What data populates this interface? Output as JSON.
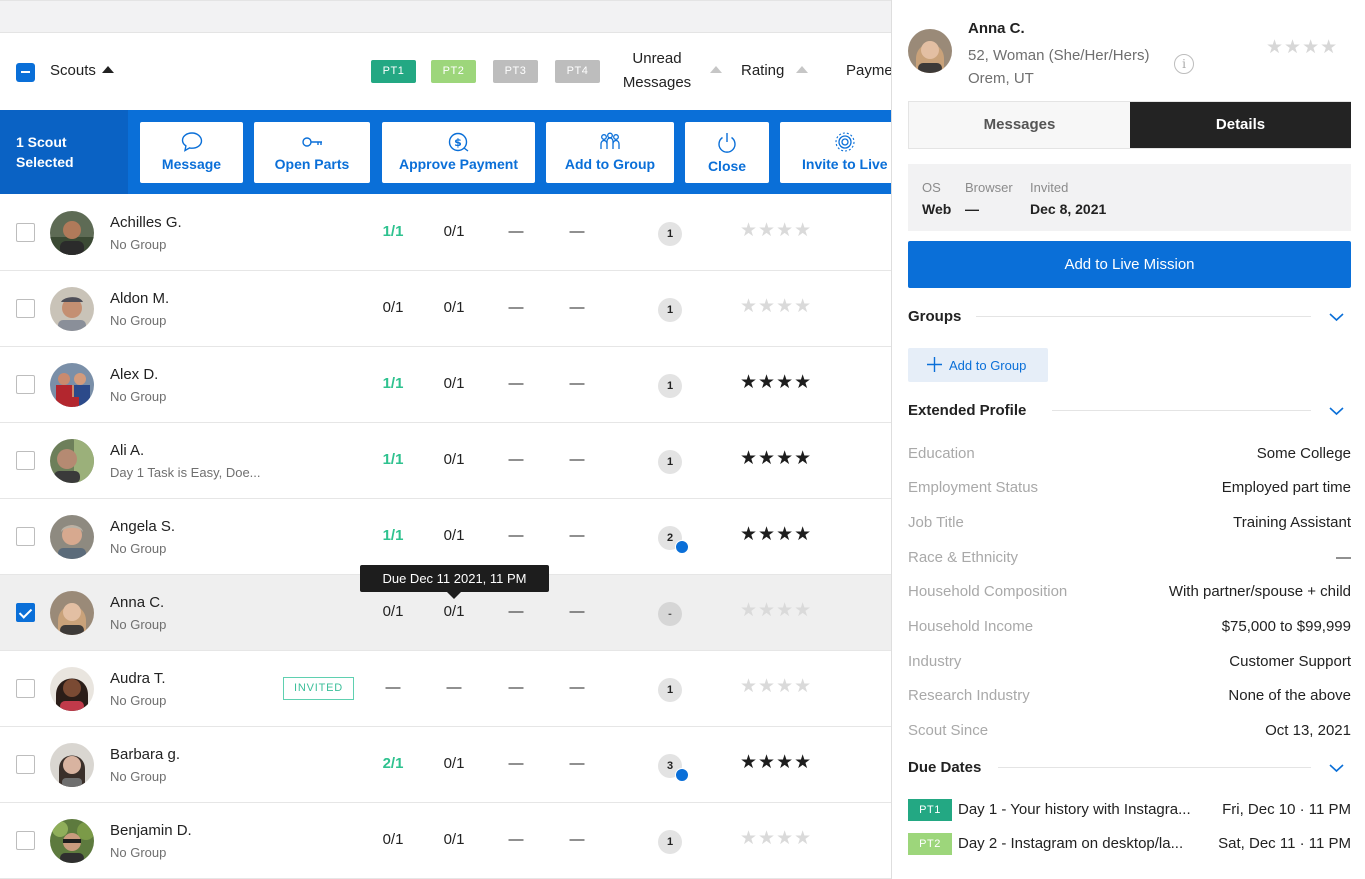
{
  "table": {
    "header": {
      "scouts_label": "Scouts",
      "pt_badges": [
        {
          "label": "PT1",
          "color": "#23a883"
        },
        {
          "label": "PT2",
          "color": "#9dd67b"
        },
        {
          "label": "PT3",
          "color": "#bdbdbd"
        },
        {
          "label": "PT4",
          "color": "#bdbdbd"
        }
      ],
      "unread_line1": "Unread",
      "unread_line2": "Messages",
      "rating_label": "Rating",
      "payment_label": "Payme"
    },
    "action_bar": {
      "selected_line1": "1 Scout",
      "selected_line2": "Selected",
      "buttons": [
        {
          "label": "Message",
          "icon": "chat-bubble-icon"
        },
        {
          "label": "Open Parts",
          "icon": "key-icon"
        },
        {
          "label": "Approve Payment",
          "icon": "dollar-circle-icon"
        },
        {
          "label": "Add to Group",
          "icon": "group-people-icon"
        },
        {
          "label": "Close",
          "icon": "power-icon"
        },
        {
          "label": "Invite to Live",
          "icon": "broadcast-icon"
        }
      ]
    },
    "rows": [
      {
        "name": "Achilles G.",
        "group": "No Group",
        "pt1": "1/1",
        "pt2": "0/1",
        "pt3": "—",
        "pt4": "—",
        "unread": "1",
        "rating": "★★★★"
      },
      {
        "name": "Aldon M.",
        "group": "No Group",
        "pt1": "0/1",
        "pt2": "0/1",
        "pt3": "—",
        "pt4": "—",
        "unread": "1",
        "rating": "★★★★"
      },
      {
        "name": "Alex D.",
        "group": "No Group",
        "pt1": "1/1",
        "pt2": "0/1",
        "pt3": "—",
        "pt4": "—",
        "unread": "1",
        "rating": "★★★★"
      },
      {
        "name": "Ali A.",
        "group": "Day 1 Task is Easy, Doe...",
        "pt1": "1/1",
        "pt2": "0/1",
        "pt3": "—",
        "pt4": "—",
        "unread": "1",
        "rating": "★★★★"
      },
      {
        "name": "Angela S.",
        "group": "No Group",
        "pt1": "1/1",
        "pt2": "0/1",
        "pt3": "—",
        "pt4": "—",
        "unread": "2",
        "rating": "★★★★"
      },
      {
        "name": "Anna C.",
        "group": "No Group",
        "pt1": "0/1",
        "pt2": "0/1",
        "pt3": "—",
        "pt4": "—",
        "unread": "-",
        "rating": "★★★★"
      },
      {
        "name": "Audra T.",
        "group": "No Group",
        "status_badge": "INVITED",
        "pt1": "—",
        "pt2": "—",
        "pt3": "—",
        "pt4": "—",
        "unread": "1",
        "rating": "★★★★"
      },
      {
        "name": "Barbara g.",
        "group": "No Group",
        "pt1": "2/1",
        "pt2": "0/1",
        "pt3": "—",
        "pt4": "—",
        "unread": "3",
        "rating": "★★★★"
      },
      {
        "name": "Benjamin D.",
        "group": "No Group",
        "pt1": "0/1",
        "pt2": "0/1",
        "pt3": "—",
        "pt4": "—",
        "unread": "1",
        "rating": "★★★★"
      }
    ],
    "tooltip": "Due Dec 11 2021, 11 PM"
  },
  "panel": {
    "name": "Anna C.",
    "demographics": "52, Woman (She/Her/Hers)",
    "location": "Orem, UT",
    "info_icon": "i",
    "stars": "★★★★",
    "tabs": {
      "messages": "Messages",
      "details": "Details"
    },
    "system": {
      "os_label": "OS",
      "os_value": "Web",
      "browser_label": "Browser",
      "browser_value": "—",
      "invited_label": "Invited",
      "invited_value": "Dec 8, 2021"
    },
    "live_button": "Add to Live Mission",
    "groups_title": "Groups",
    "add_group_button": "Add to Group",
    "extended_title": "Extended Profile",
    "profile": [
      {
        "key": "Education",
        "value": "Some College"
      },
      {
        "key": "Employment Status",
        "value": "Employed part time"
      },
      {
        "key": "Job Title",
        "value": "Training Assistant"
      },
      {
        "key": "Race & Ethnicity",
        "value": "—"
      },
      {
        "key": "Household Composition",
        "value": "With partner/spouse + child"
      },
      {
        "key": "Household Income",
        "value": "$75,000 to $99,999"
      },
      {
        "key": "Industry",
        "value": "Customer Support"
      },
      {
        "key": "Research Industry",
        "value": "None of the above"
      },
      {
        "key": "Scout Since",
        "value": "Oct 13, 2021"
      }
    ],
    "due_title": "Due Dates",
    "due_dates": [
      {
        "pt": "PT1",
        "color": "#23a883",
        "task": "Day 1 - Your history with Instagra...",
        "date": "Fri, Dec 10 · 11 PM"
      },
      {
        "pt": "PT2",
        "color": "#9dd67b",
        "task": "Day 2 - Instagram on desktop/la...",
        "date": "Sat, Dec 11 · 11 PM"
      }
    ]
  }
}
